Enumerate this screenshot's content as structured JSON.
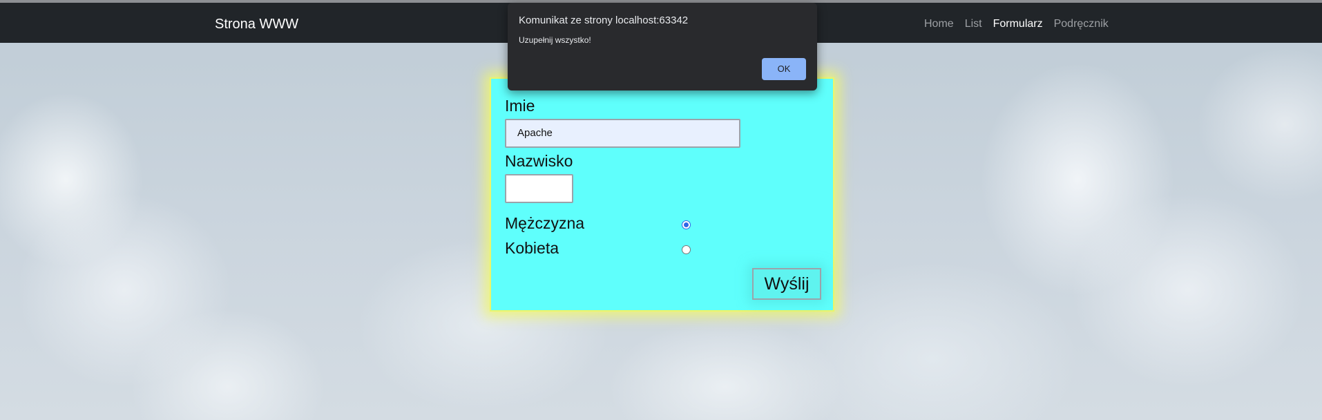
{
  "navbar": {
    "brand": "Strona WWW",
    "links": [
      {
        "label": "Home",
        "active": false
      },
      {
        "label": "List",
        "active": false
      },
      {
        "label": "Formularz",
        "active": true
      },
      {
        "label": "Podręcznik",
        "active": false
      }
    ]
  },
  "form": {
    "first_name_label": "Imie",
    "first_name_value": "Apache",
    "last_name_label": "Nazwisko",
    "last_name_value": "",
    "gender_options": [
      {
        "label": "Mężczyzna",
        "checked": true
      },
      {
        "label": "Kobieta",
        "checked": false
      }
    ],
    "submit_label": "Wyślij"
  },
  "dialog": {
    "title": "Komunikat ze strony localhost:63342",
    "message": "Uzupełnij wszystko!",
    "ok_label": "OK"
  },
  "colors": {
    "navbar_bg": "#212529",
    "form_bg": "#5ffffc",
    "form_border": "#ecf56a",
    "dialog_bg": "#292a2d",
    "dialog_button": "#8ab4f8"
  }
}
